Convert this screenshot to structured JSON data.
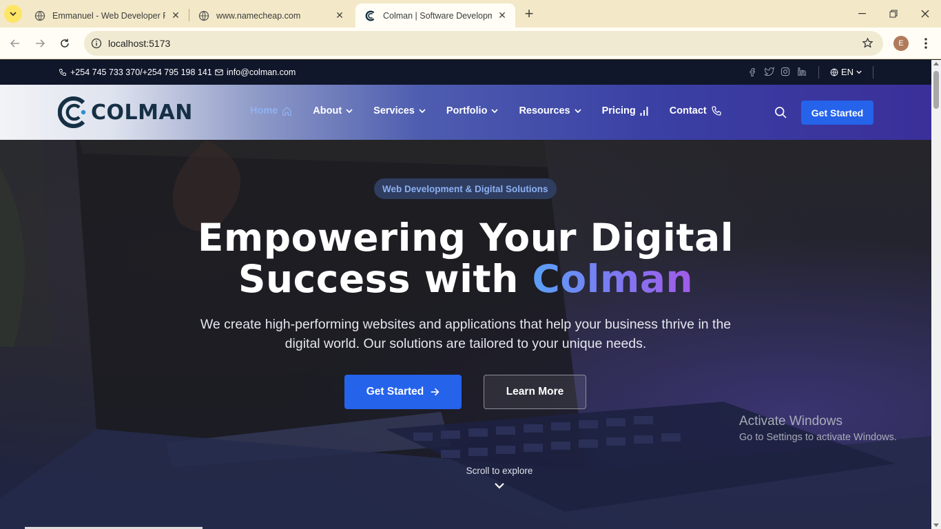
{
  "browser": {
    "tabs": [
      {
        "title": "Emmanuel - Web Developer Po",
        "favicon": "globe-icon",
        "active": false
      },
      {
        "title": "www.namecheap.com",
        "favicon": "globe-icon",
        "active": false
      },
      {
        "title": "Colman | Software Developmen",
        "favicon": "colman-logo-icon",
        "active": true
      }
    ],
    "url": "localhost:5173",
    "profile_initial": "E",
    "theme_color": "#f3e9c8"
  },
  "topbar": {
    "phone": "+254 745 733 370/+254 795 198 141",
    "email": "info@colman.com",
    "language": "EN",
    "socials": [
      "facebook-icon",
      "twitter-icon",
      "instagram-icon",
      "linkedin-icon"
    ]
  },
  "nav": {
    "logo_text": "COLMAN",
    "items": [
      {
        "label": "Home",
        "icon": "home-icon",
        "active": true
      },
      {
        "label": "About",
        "icon": "chevron-down-icon"
      },
      {
        "label": "Services",
        "icon": "chevron-down-icon"
      },
      {
        "label": "Portfolio",
        "icon": "chevron-down-icon"
      },
      {
        "label": "Resources",
        "icon": "chevron-down-icon"
      },
      {
        "label": "Pricing",
        "icon": "bar-chart-icon"
      },
      {
        "label": "Contact",
        "icon": "phone-icon"
      }
    ],
    "cta_label": "Get Started",
    "accent": "#2563eb"
  },
  "hero": {
    "badge": "Web Development & Digital Solutions",
    "headline_line1": "Empowering Your Digital",
    "headline_line2_prefix": "Success with",
    "headline_accent": "Colman",
    "subtext": "We create high-performing websites and applications that help your business thrive in the digital world. Our solutions are tailored to your unique needs.",
    "primary_button": "Get Started",
    "secondary_button": "Learn More",
    "scroll_hint": "Scroll to explore"
  },
  "os_watermark": {
    "line1": "Activate Windows",
    "line2": "Go to Settings to activate Windows."
  }
}
